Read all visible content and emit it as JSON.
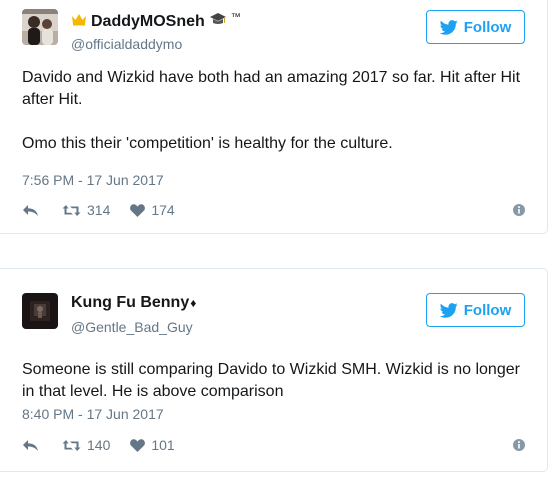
{
  "colors": {
    "twitter_blue": "#1da1f2",
    "secondary_text": "#657786",
    "primary_text": "#14171a",
    "border": "#e1e8ed",
    "crown": "#f5b800"
  },
  "icons": {
    "follow": "twitter-bird-icon",
    "reply": "reply-icon",
    "retweet": "retweet-icon",
    "like": "heart-icon",
    "more": "info-icon"
  },
  "tweets": [
    {
      "display_name": "DaddyMOSneh",
      "name_prefix_icon": "crown-emoji",
      "name_suffix_icons": [
        "graduation-cap-emoji"
      ],
      "name_suffix_text": "™",
      "handle": "@officialdaddymo",
      "follow_label": "Follow",
      "text": [
        "Davido and Wizkid have both had an amazing 2017 so far. Hit after Hit after Hit.",
        "Omo this their 'competition' is healthy for the culture."
      ],
      "timestamp": "7:56 PM - 17 Jun 2017",
      "retweets": "314",
      "likes": "174"
    },
    {
      "display_name": "Kung Fu Benny",
      "name_suffix_text": "♦",
      "handle": "@Gentle_Bad_Guy",
      "follow_label": "Follow",
      "text": [
        "Someone is still comparing Davido to Wizkid SMH. Wizkid is no longer in that level. He is above comparison"
      ],
      "timestamp": "8:40 PM - 17 Jun 2017",
      "retweets": "140",
      "likes": "101"
    }
  ]
}
